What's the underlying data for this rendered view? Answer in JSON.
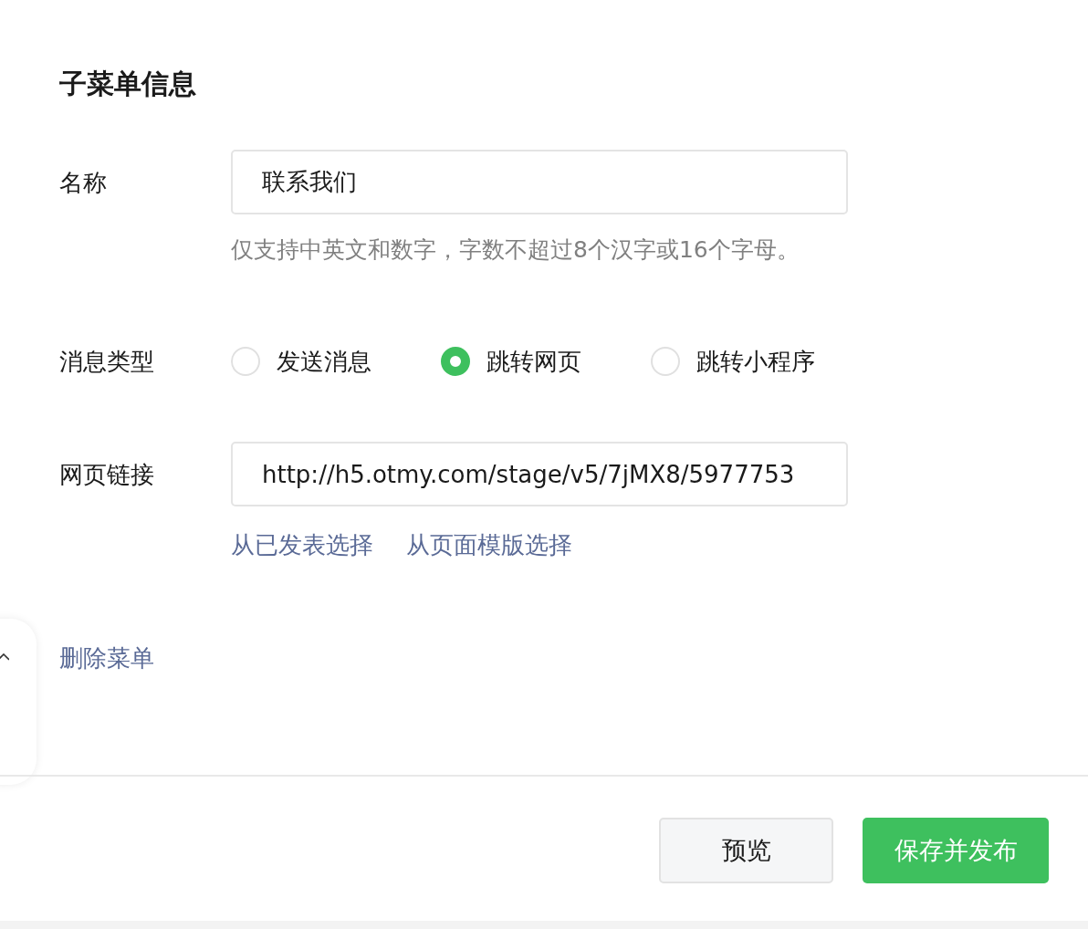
{
  "section_title": "子菜单信息",
  "name_field": {
    "label": "名称",
    "value": "联系我们",
    "hint": "仅支持中英文和数字，字数不超过8个汉字或16个字母。"
  },
  "message_type": {
    "label": "消息类型",
    "options": [
      {
        "label": "发送消息",
        "selected": false
      },
      {
        "label": "跳转网页",
        "selected": true
      },
      {
        "label": "跳转小程序",
        "selected": false
      }
    ]
  },
  "url_field": {
    "label": "网页链接",
    "value": "http://h5.otmy.com/stage/v5/7jMX8/5977753",
    "links": [
      "从已发表选择",
      "从页面模版选择"
    ]
  },
  "delete_link": "删除菜单",
  "buttons": [
    {
      "label": "预览",
      "kind": "secondary"
    },
    {
      "label": "保存并发布",
      "kind": "primary"
    }
  ]
}
